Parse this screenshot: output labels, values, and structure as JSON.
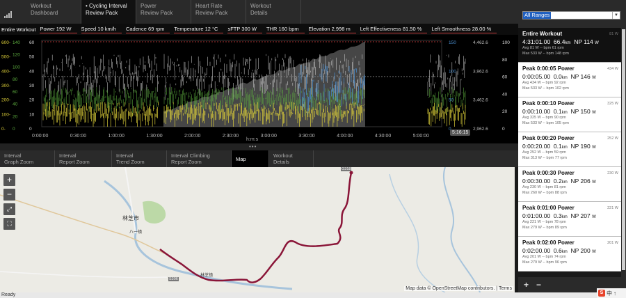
{
  "top_tabs": [
    {
      "line1": "Workout",
      "line2": "Dashboard",
      "active": false
    },
    {
      "line1": "• Cycling Interval",
      "line2": "Review Pack",
      "active": true
    },
    {
      "line1": "Power",
      "line2": "Review Pack",
      "active": false
    },
    {
      "line1": "Heart Rate",
      "line2": "Review Pack",
      "active": false
    },
    {
      "line1": "Workout",
      "line2": "Details",
      "active": false
    }
  ],
  "stats": {
    "label": "Entire Workout",
    "items": [
      "Power 192 W",
      "Speed 10 km/h",
      "Cadence 69 rpm",
      "Temperature 12 °C",
      "sFTP 300 W",
      "THR 160 bpm",
      "Elevation 2,998 m",
      "Left Effectiveness 81.50 %",
      "Left Smoothness 28.00 %"
    ]
  },
  "chart": {
    "x_ticks": [
      "0:00:00",
      "0:30:00",
      "1:00:00",
      "1:30:00",
      "2:00:00",
      "2:30:00",
      "3:00:00",
      "3:30:00",
      "4:00:00",
      "4:30:00",
      "5:00:00"
    ],
    "x_unit": "h:m:s",
    "end_time": "5:16:15",
    "left_power_ticks": [
      "600-",
      "500-",
      "400-",
      "300-",
      "200-",
      "100-",
      "0-"
    ],
    "left_cad_ticks": [
      "140",
      "120",
      "100",
      "80",
      "60",
      "40",
      "20",
      "0"
    ],
    "left_hr_ticks": [
      "60",
      "50",
      "40",
      "30",
      "20",
      "10",
      "0"
    ],
    "right_speed_ticks": [
      "150",
      "100",
      "50",
      "0"
    ],
    "right_elev_ticks": [
      "4,462.6",
      "3,962.6",
      "3,462.6",
      "2,962.6"
    ],
    "right_temp_ticks": [
      "100",
      "80",
      "60",
      "40",
      "20",
      "0"
    ],
    "colors": {
      "power": "#e0d23a",
      "hr": "#d8d8d8",
      "cadence": "#5fb040",
      "speed": "#4a8ed0",
      "elevation": "#808080"
    }
  },
  "lower_tabs": [
    {
      "line1": "Interval",
      "line2": "Graph Zoom",
      "active": false
    },
    {
      "line1": "Interval",
      "line2": "Report Zoom",
      "active": false
    },
    {
      "line1": "Interval",
      "line2": "Trend Zoom",
      "active": false
    },
    {
      "line1": "Interval Climbing",
      "line2": "Report Zoom",
      "active": false
    },
    {
      "line1": "Map",
      "line2": "",
      "active": true
    },
    {
      "line1": "Workout",
      "line2": "Details",
      "active": false
    }
  ],
  "map": {
    "attribution": "Map data © OpenStreetMap contributors. |  Terms",
    "city": "林芝市",
    "town": "八一镇",
    "road1": "G318",
    "road2": "S306",
    "place": "林芝镇",
    "route_color": "#8a1538"
  },
  "status": "Ready",
  "right_panel": {
    "range_select": "All Ranges",
    "cards": [
      {
        "title": "Entire Workout",
        "tag": "81 W",
        "time": "4:31:01.00",
        "dist": "66.4",
        "dist_unit": "km",
        "np": "NP 114",
        "np_unit": "W",
        "avg": "Avg  81 W  -- bpm  61 rpm",
        "max": "Max  533 W  -- bpm  148 rpm",
        "active": true
      },
      {
        "title": "Peak 0:00:05 Power",
        "tag": "434 W",
        "time": "0:00:05.00",
        "dist": "0.0",
        "dist_unit": "km",
        "np": "NP 146",
        "np_unit": "W",
        "avg": "Avg  434 W  -- bpm  92 rpm",
        "max": "Max  533 W  -- bpm  102 rpm",
        "active": false
      },
      {
        "title": "Peak 0:00:10 Power",
        "tag": "325 W",
        "time": "0:00:10.00",
        "dist": "0.1",
        "dist_unit": "km",
        "np": "NP 150",
        "np_unit": "W",
        "avg": "Avg  325 W  -- bpm  90 rpm",
        "max": "Max  533 W  -- bpm  105 rpm",
        "active": false
      },
      {
        "title": "Peak 0:00:20 Power",
        "tag": "252 W",
        "time": "0:00:20.00",
        "dist": "0.1",
        "dist_unit": "km",
        "np": "NP 190",
        "np_unit": "W",
        "avg": "Avg  252 W  -- bpm  59 rpm",
        "max": "Max  313 W  -- bpm  77 rpm",
        "active": false
      },
      {
        "title": "Peak 0:00:30 Power",
        "tag": "230 W",
        "time": "0:00:30.00",
        "dist": "0.2",
        "dist_unit": "km",
        "np": "NP 206",
        "np_unit": "W",
        "avg": "Avg  230 W  -- bpm  81 rpm",
        "max": "Max  260 W  -- bpm  88 rpm",
        "active": false
      },
      {
        "title": "Peak 0:01:00 Power",
        "tag": "221 W",
        "time": "0:01:00.00",
        "dist": "0.3",
        "dist_unit": "km",
        "np": "NP 207",
        "np_unit": "W",
        "avg": "Avg  221 W  -- bpm  78 rpm",
        "max": "Max  279 W  -- bpm  89 rpm",
        "active": false
      },
      {
        "title": "Peak 0:02:00 Power",
        "tag": "201 W",
        "time": "0:02:00.00",
        "dist": "0.6",
        "dist_unit": "km",
        "np": "NP 200",
        "np_unit": "W",
        "avg": "Avg  201 W  -- bpm  74 rpm",
        "max": "Max  279 W  -- bpm  96 rpm",
        "active": false
      }
    ]
  }
}
